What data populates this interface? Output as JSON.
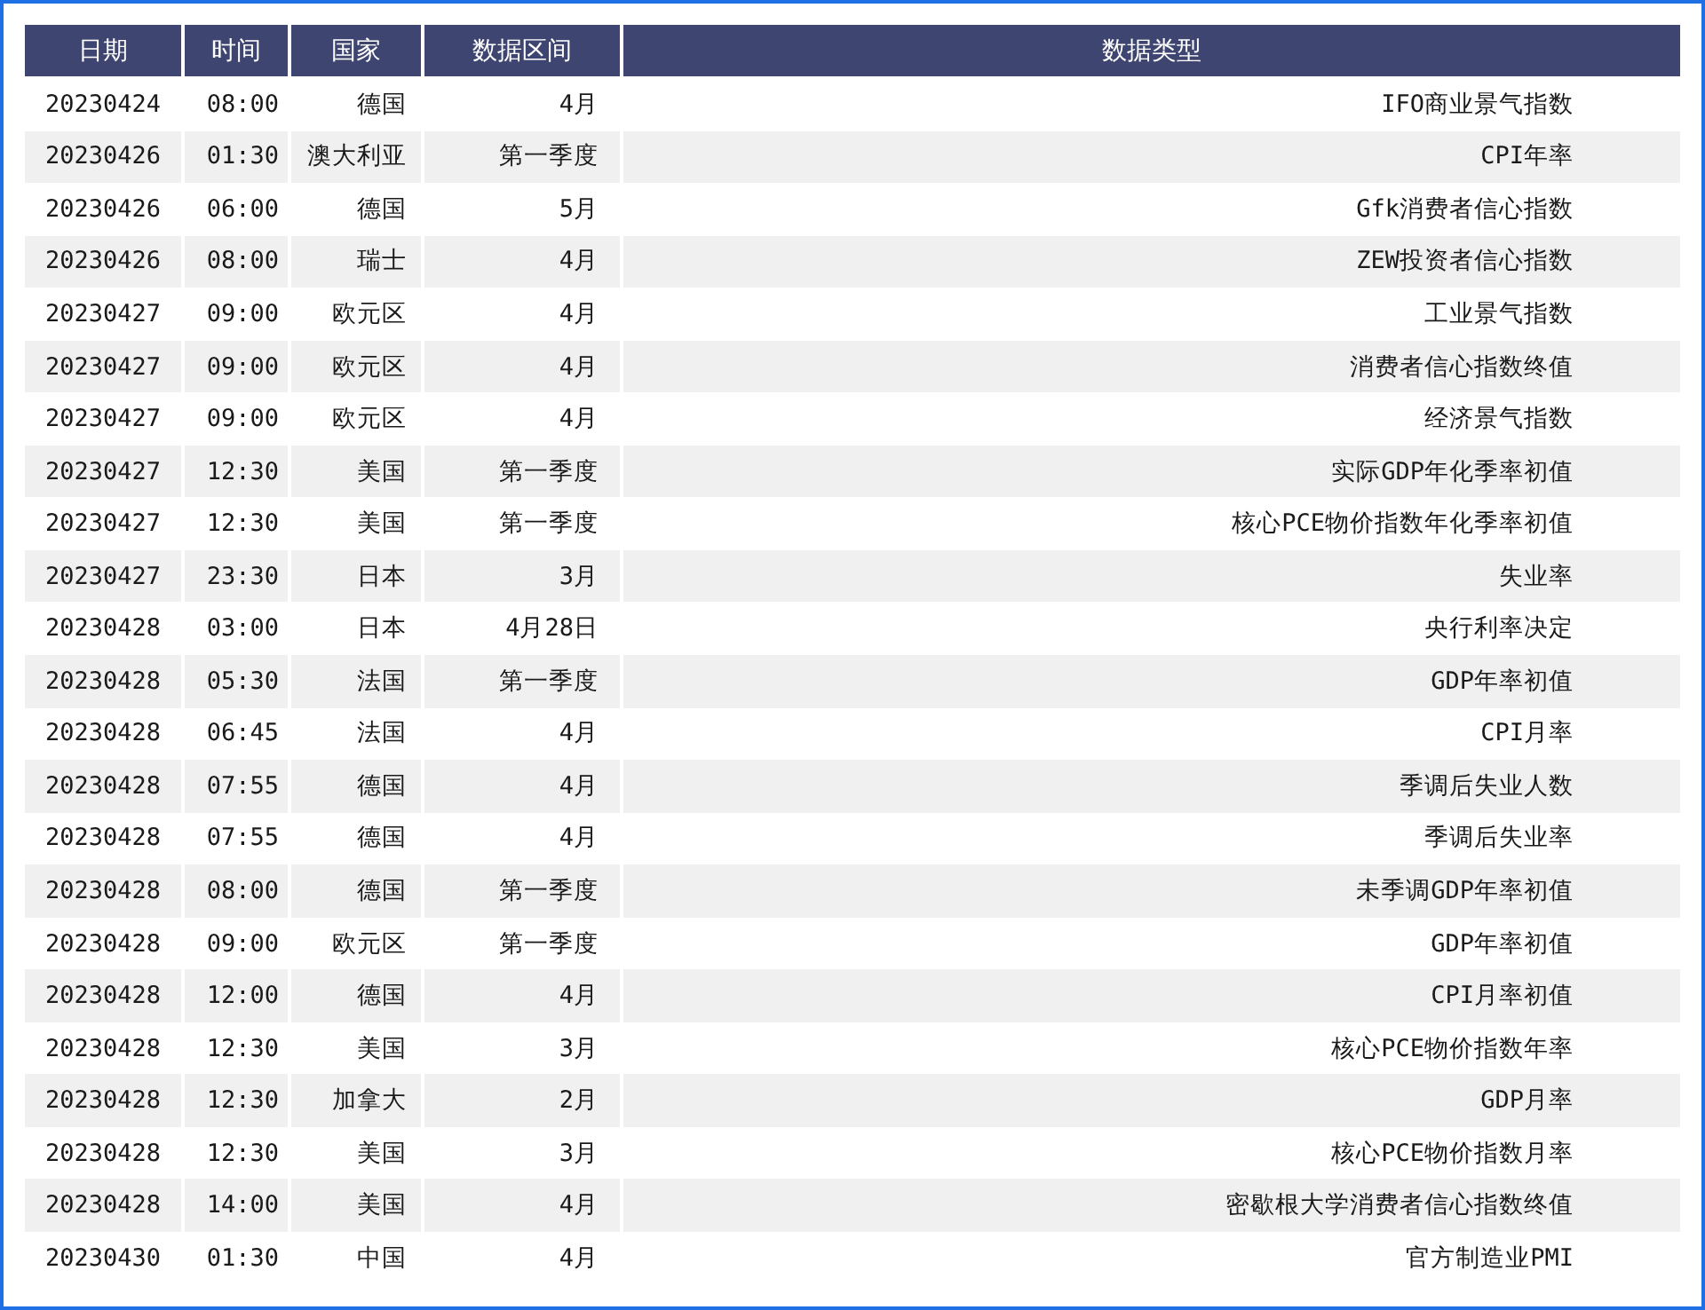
{
  "table": {
    "columns": [
      "日期",
      "时间",
      "国家",
      "数据区间",
      "数据类型"
    ],
    "rows": [
      [
        "20230424",
        "08:00",
        "德国",
        "4月",
        "IFO商业景气指数"
      ],
      [
        "20230426",
        "01:30",
        "澳大利亚",
        "第一季度",
        "CPI年率"
      ],
      [
        "20230426",
        "06:00",
        "德国",
        "5月",
        "Gfk消费者信心指数"
      ],
      [
        "20230426",
        "08:00",
        "瑞士",
        "4月",
        "ZEW投资者信心指数"
      ],
      [
        "20230427",
        "09:00",
        "欧元区",
        "4月",
        "工业景气指数"
      ],
      [
        "20230427",
        "09:00",
        "欧元区",
        "4月",
        "消费者信心指数终值"
      ],
      [
        "20230427",
        "09:00",
        "欧元区",
        "4月",
        "经济景气指数"
      ],
      [
        "20230427",
        "12:30",
        "美国",
        "第一季度",
        "实际GDP年化季率初值"
      ],
      [
        "20230427",
        "12:30",
        "美国",
        "第一季度",
        "核心PCE物价指数年化季率初值"
      ],
      [
        "20230427",
        "23:30",
        "日本",
        "3月",
        "失业率"
      ],
      [
        "20230428",
        "03:00",
        "日本",
        "4月28日",
        "央行利率决定"
      ],
      [
        "20230428",
        "05:30",
        "法国",
        "第一季度",
        "GDP年率初值"
      ],
      [
        "20230428",
        "06:45",
        "法国",
        "4月",
        "CPI月率"
      ],
      [
        "20230428",
        "07:55",
        "德国",
        "4月",
        "季调后失业人数"
      ],
      [
        "20230428",
        "07:55",
        "德国",
        "4月",
        "季调后失业率"
      ],
      [
        "20230428",
        "08:00",
        "德国",
        "第一季度",
        "未季调GDP年率初值"
      ],
      [
        "20230428",
        "09:00",
        "欧元区",
        "第一季度",
        "GDP年率初值"
      ],
      [
        "20230428",
        "12:00",
        "德国",
        "4月",
        "CPI月率初值"
      ],
      [
        "20230428",
        "12:30",
        "美国",
        "3月",
        "核心PCE物价指数年率"
      ],
      [
        "20230428",
        "12:30",
        "加拿大",
        "2月",
        "GDP月率"
      ],
      [
        "20230428",
        "12:30",
        "美国",
        "3月",
        "核心PCE物价指数月率"
      ],
      [
        "20230428",
        "14:00",
        "美国",
        "4月",
        "密歇根大学消费者信心指数终值"
      ],
      [
        "20230430",
        "01:30",
        "中国",
        "4月",
        "官方制造业PMI"
      ]
    ]
  }
}
